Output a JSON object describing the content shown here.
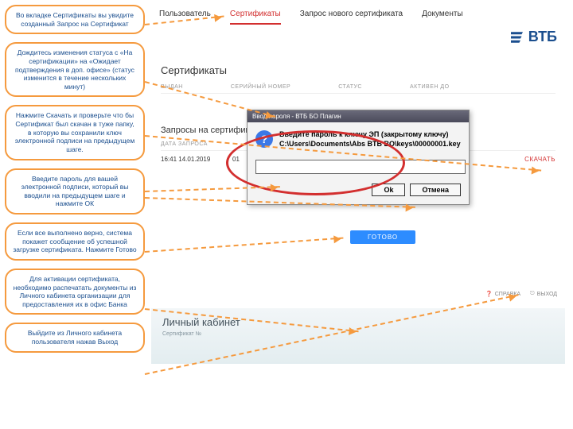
{
  "brand": "ВТБ",
  "tabs": {
    "user": "Пользователь",
    "certs": "Сертификаты",
    "request": "Запрос нового сертификата",
    "docs": "Документы"
  },
  "certs": {
    "title": "Сертификаты",
    "cols": {
      "issued": "ВЫДАН",
      "serial": "СЕРИЙНЫЙ НОМЕР",
      "status": "СТАТУС",
      "active": "АКТИВЕН ДО"
    }
  },
  "reqs": {
    "title": "Запросы на сертификат",
    "col_date": "ДАТА ЗАПРОСА",
    "row": {
      "ts": "16:41 14.01.2019",
      "id": "01",
      "download": "СКАЧАТЬ"
    }
  },
  "dialog": {
    "title": "Ввод пароля - ВТБ БО Плагин",
    "msg1": "Введите пароль к ключу ЭП (закрытому ключу)",
    "msg2": "C:\\Users\\Documents\\Abs BTB BO\\keys\\00000001.key",
    "ok": "Ok",
    "cancel": "Отмена"
  },
  "gotovo": "ГОТОВО",
  "lk": {
    "help": "СПРАВКА",
    "exit": "ВЫХОД",
    "title": "Личный кабинет",
    "sub": "Сертификат №"
  },
  "callouts": {
    "c1": "Во вкладке Сертификаты вы увидите созданный Запрос на Сертификат",
    "c2": "Дождитесь изменения статуса с «На сертификации» на «Ожидает подтверждения в доп. офисе» (статус изменится в течение нескольких минут)",
    "c3": "Нажмите Скачать и проверьте что бы Сертификат был скачан в туже папку, в которую вы сохранили ключ электронной подписи на предыдущем шаге.",
    "c4": "Введите пароль для вашей электронной подписи, который вы вводили на предыдущем шаге и нажмите ОК",
    "c5": "Если все выполнено верно, система покажет сообщение об успешной загрузке сертификата.\nНажмите Готово",
    "c6": "Для активации сертификата, необходимо распечатать документы из Личного кабинета организации для предоставления их в офис Банка",
    "c7": "Выйдите из Личного кабинета пользователя нажав Выход"
  }
}
